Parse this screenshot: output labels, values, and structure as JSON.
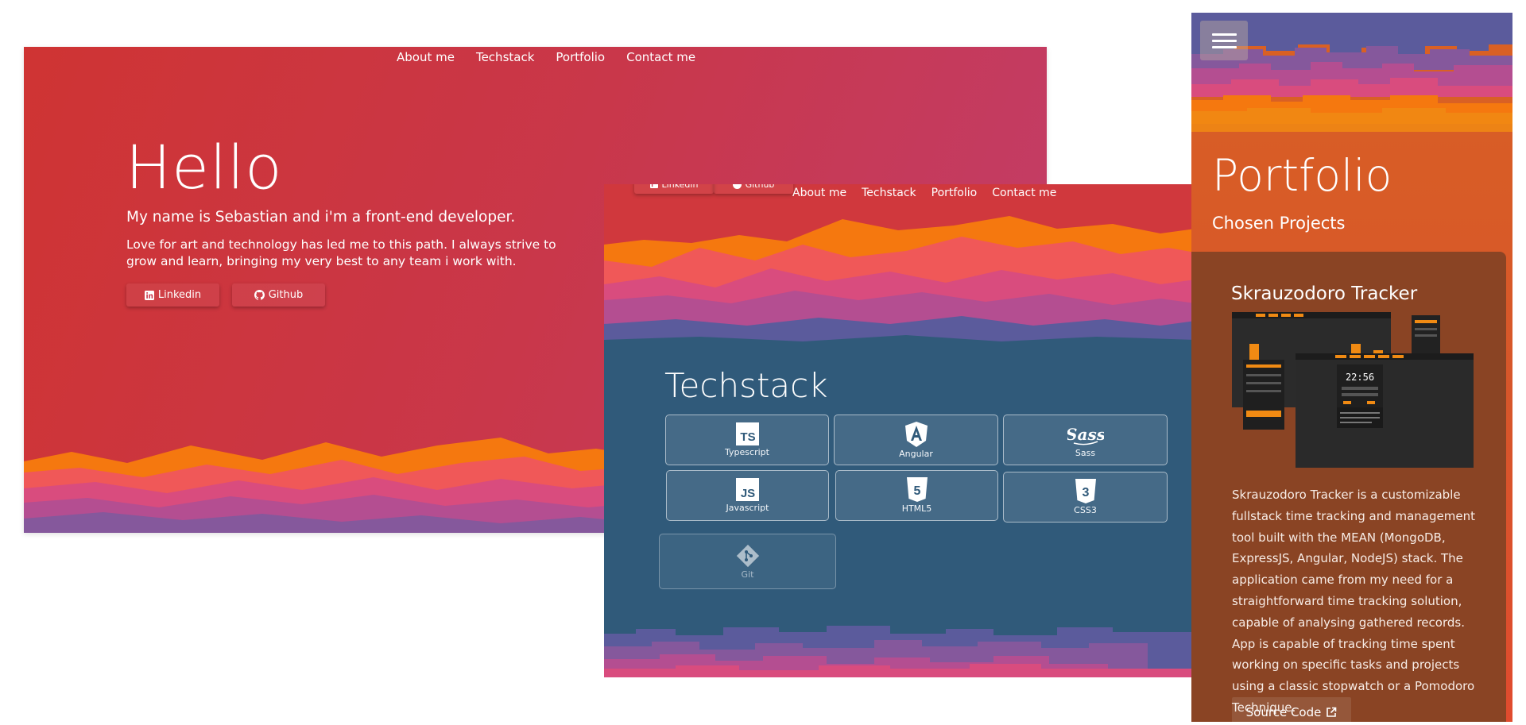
{
  "nav": {
    "items": [
      {
        "label": "About me"
      },
      {
        "label": "Techstack"
      },
      {
        "label": "Portfolio"
      },
      {
        "label": "Contact me"
      }
    ]
  },
  "hero": {
    "heading": "Hello",
    "intro": "My name is Sebastian and i'm a front-end developer.",
    "description": "Love for art and technology has led me to this path. I always strive to grow and learn, bringing my very best to any team i work with.",
    "linkedin_label": "Linkedin",
    "github_label": "Github"
  },
  "techstack": {
    "title": "Techstack",
    "items": [
      {
        "label": "Typescript",
        "icon": "typescript-icon"
      },
      {
        "label": "Angular",
        "icon": "angular-icon"
      },
      {
        "label": "Sass",
        "icon": "sass-icon"
      },
      {
        "label": "Javascript",
        "icon": "javascript-icon"
      },
      {
        "label": "HTML5",
        "icon": "html5-icon"
      },
      {
        "label": "CSS3",
        "icon": "css3-icon"
      },
      {
        "label": "Git",
        "icon": "git-icon"
      }
    ]
  },
  "portfolio": {
    "title": "Portfolio",
    "subtitle": "Chosen Projects",
    "project": {
      "title": "Skrauzodoro Tracker",
      "screenshot_timer": "22:56",
      "description": "Skrauzodoro Tracker is a customizable fullstack time tracking and management tool built with the MEAN (MongoDB, ExpressJS, Angular, NodeJS) stack. The application came from my need for a straightforward time tracking solution, capable of analysing gathered records. App is capable of tracking time spent working on specific tasks and projects using a classic stopwatch or a Pomodoro Technique.",
      "source_label": "Source Code"
    }
  },
  "colors": {
    "hero_gradient_start": "#cf3433",
    "hero_gradient_end": "#c23d6a",
    "techstack_bg": "#305a7a",
    "portfolio_bg": "#d85a27",
    "wave_orange": "#f5780f",
    "wave_coral": "#f05858",
    "wave_pink": "#d94c7e",
    "wave_magenta": "#b44e91",
    "wave_purple": "#85589c",
    "wave_indigo": "#5b5b9c",
    "accent_orange": "#f08a13"
  }
}
